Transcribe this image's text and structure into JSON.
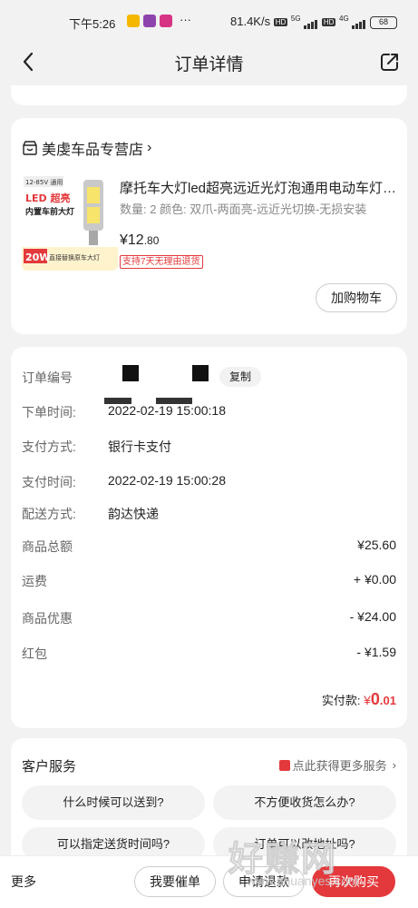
{
  "status": {
    "time": "下午5:26",
    "network_speed": "81.4K/s",
    "net_badges": [
      "HD",
      "5G",
      "HD",
      "4G"
    ],
    "battery": "68"
  },
  "header": {
    "title": "订单详情"
  },
  "shop": {
    "name": "美虔车品专营店",
    "arrow": "›"
  },
  "product": {
    "image_badge": "12-85V 通用",
    "image_line1": "LED 超亮",
    "image_line2": "内置车前大灯",
    "image_watt": "20W",
    "image_footer": "直接替换原车大灯",
    "title": "摩托车大灯led超亮远近光灯泡通用电动车灯…",
    "spec": "数量: 2  颜色: 双爪-两面亮-远近光切换-无损安装",
    "price_currency": "¥",
    "price_int": "12",
    "price_dec": ".80",
    "tag": "支持7天无理由退货",
    "add_cart_label": "加购物车"
  },
  "order": {
    "number_label": "订单编号",
    "copy_label": "复制",
    "order_time_label": "下单时间:",
    "order_time": "2022-02-19 15:00:18",
    "pay_method_label": "支付方式:",
    "pay_method": "银行卡支付",
    "pay_time_label": "支付时间:",
    "pay_time": "2022-02-19 15:00:28",
    "delivery_label": "配送方式:",
    "delivery": "韵达快递",
    "amounts": [
      {
        "label": "商品总额",
        "value": "¥25.60"
      },
      {
        "label": "运费",
        "value": "+ ¥0.00"
      },
      {
        "label": "商品优惠",
        "value": "- ¥24.00"
      },
      {
        "label": "红包",
        "value": "- ¥1.59"
      }
    ],
    "paid_label": "实付款:",
    "paid_currency": "¥",
    "paid_int": "0",
    "paid_dec": ".01"
  },
  "service": {
    "title": "客户服务",
    "more": "点此获得更多服务",
    "chips": [
      "什么时候可以送到?",
      "不方便收货怎么办?",
      "可以指定送货时间吗?",
      "订单可以改地址吗?"
    ]
  },
  "bottom": {
    "more": "更多",
    "urge": "我要催单",
    "aftersale": "申请退款",
    "buy_again": "再次购买"
  },
  "watermark": {
    "text": "好赚网",
    "url": "www.zhuanyes.com"
  },
  "colors": {
    "accent": "#e4393c",
    "background": "#f2f2f2"
  }
}
